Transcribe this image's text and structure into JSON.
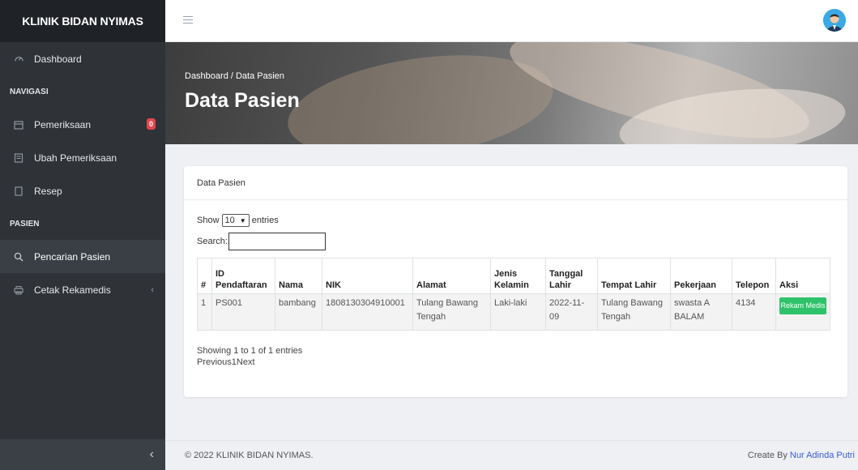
{
  "brand": "KLINIK BIDAN NYIMAS",
  "sidebar": {
    "dashboard": "Dashboard",
    "heading_navigasi": "NAVIGASI",
    "pemeriksaan": "Pemeriksaan",
    "pemeriksaan_badge": "0",
    "ubah_pemeriksaan": "Ubah Pemeriksaan",
    "resep": "Resep",
    "heading_pasien": "PASIEN",
    "pencarian_pasien": "Pencarian Pasien",
    "cetak_rekamedis": "Cetak Rekamedis",
    "collapse_glyph": "‹"
  },
  "header": {
    "breadcrumb": "Dashboard / Data Pasien",
    "title": "Data Pasien"
  },
  "card": {
    "title": "Data Pasien",
    "show_label": "Show",
    "entries_value": "10",
    "entries_label": "entries",
    "search_label": "Search:",
    "search_value": "",
    "columns": {
      "no": "#",
      "id_pendaftaran": "ID Pendaftaran",
      "nama": "Nama",
      "nik": "NIK",
      "alamat": "Alamat",
      "jenis_kelamin": "Jenis Kelamin",
      "tanggal_lahir": "Tanggal Lahir",
      "tempat_lahir": "Tempat Lahir",
      "pekerjaan": "Pekerjaan",
      "telepon": "Telepon",
      "aksi": "Aksi"
    },
    "rows": [
      {
        "no": "1",
        "id_pendaftaran": "PS001",
        "nama": "bambang",
        "nik": "1808130304910001",
        "alamat": "Tulang Bawang Tengah",
        "jenis_kelamin": "Laki-laki",
        "tanggal_lahir": "2022-11-09",
        "tempat_lahir": "Tulang Bawang Tengah",
        "pekerjaan": "swasta A BALAM",
        "telepon": "4134",
        "action": "Rekam Medis"
      }
    ],
    "info": "Showing 1 to 1 of 1 entries",
    "pagination": "Previous1Next"
  },
  "footer": {
    "copyright": "© 2022 KLINIK BIDAN NYIMAS.",
    "credit_prefix": "Create By ",
    "credit_author": "Nur Adinda Putri"
  },
  "colors": {
    "sidebar_bg": "#2f3338",
    "brand_bg": "#1f2226",
    "badge": "#e0474c",
    "action_button": "#2ec36a",
    "author_link": "#3b5bd9"
  },
  "icons": {
    "dashboard": "dashboard-icon",
    "pemeriksaan": "calendar-icon",
    "ubah_pemeriksaan": "edit-list-icon",
    "resep": "document-icon",
    "pencarian_pasien": "search-icon",
    "cetak_rekamedis": "printer-icon",
    "menu": "hamburger-icon",
    "user": "user-avatar-icon"
  }
}
